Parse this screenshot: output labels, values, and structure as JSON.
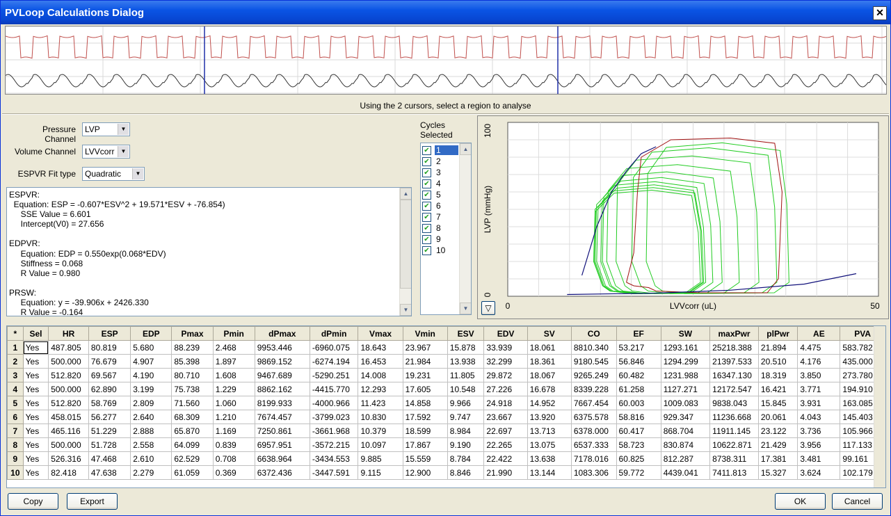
{
  "window": {
    "title": "PVLoop Calculations Dialog",
    "close_glyph": "✕"
  },
  "overview": {
    "hint": "Using the 2 cursors, select a region to analyse",
    "colors": {
      "pressure": "#c0504d",
      "volume": "#333333",
      "cursor": "#1f2fa8"
    }
  },
  "settings": {
    "pressure_label": "Pressure Channel",
    "pressure_value": "LVP",
    "volume_label": "Volume Channel",
    "volume_value": "LVVcorr",
    "espvr_label": "ESPVR Fit type",
    "espvr_value": "Quadratic"
  },
  "results_text": [
    "ESPVR:",
    "  Equation: ESP = -0.607*ESV^2 + 19.571*ESV + -76.854)",
    "     SSE Value = 6.601",
    "     Intercept(V0) = 27.656",
    "",
    "EDPVR:",
    "     Equation: EDP = 0.550exp(0.068*EDV)",
    "     Stiffness = 0.068",
    "     R Value = 0.980",
    "",
    "PRSW:",
    "     Equation: y = -39.906x + 2426.330",
    "     R Value = -0.164"
  ],
  "cycles": {
    "label_line1": "Cycles",
    "label_line2": "Selected",
    "items": [
      "1",
      "2",
      "3",
      "4",
      "5",
      "6",
      "7",
      "8",
      "9",
      "10"
    ],
    "selected_index": 0
  },
  "chart_data": {
    "type": "line",
    "xlabel": "LVVcorr (uL)",
    "ylabel": "LVP (mmHg)",
    "xlim": [
      0,
      50
    ],
    "ylim": [
      0,
      100
    ],
    "x_ticks": [
      "0",
      "50"
    ],
    "y_ticks": [
      "0",
      "100"
    ],
    "grid": true,
    "colors": {
      "loops": "#22cc22",
      "highlight": "#a01010",
      "fit": "#10107a"
    },
    "espvr_curve": [
      [
        10,
        12
      ],
      [
        12,
        40
      ],
      [
        14,
        60
      ],
      [
        16,
        72
      ],
      [
        18,
        82
      ],
      [
        20,
        86
      ]
    ],
    "edpvr_curve": [
      [
        8,
        1
      ],
      [
        20,
        1.8
      ],
      [
        30,
        3.5
      ],
      [
        40,
        7
      ],
      [
        47,
        13
      ]
    ],
    "highlight_loop": [
      [
        16,
        8
      ],
      [
        17,
        25
      ],
      [
        17.5,
        60
      ],
      [
        18,
        80
      ],
      [
        22,
        90
      ],
      [
        30,
        91
      ],
      [
        36,
        88
      ],
      [
        37,
        60
      ],
      [
        36.5,
        10
      ],
      [
        35,
        2
      ],
      [
        26,
        2
      ],
      [
        20,
        3
      ],
      [
        19,
        5
      ],
      [
        17,
        6
      ],
      [
        16,
        8
      ]
    ],
    "loops": [
      {
        "esv": 15.878,
        "edv": 33.939,
        "pmax": 88.239
      },
      {
        "esv": 13.938,
        "edv": 32.299,
        "pmax": 85.398
      },
      {
        "esv": 11.805,
        "edv": 29.872,
        "pmax": 80.71
      },
      {
        "esv": 10.548,
        "edv": 27.226,
        "pmax": 75.738
      },
      {
        "esv": 9.966,
        "edv": 24.918,
        "pmax": 71.56
      },
      {
        "esv": 9.747,
        "edv": 23.667,
        "pmax": 68.309
      },
      {
        "esv": 8.984,
        "edv": 22.697,
        "pmax": 65.87
      },
      {
        "esv": 9.19,
        "edv": 22.265,
        "pmax": 64.099
      },
      {
        "esv": 8.784,
        "edv": 22.422,
        "pmax": 62.529
      },
      {
        "esv": 8.846,
        "edv": 21.99,
        "pmax": 61.059
      }
    ],
    "zoom_glyph": "▽"
  },
  "table": {
    "corner": "*",
    "columns": [
      "Sel",
      "HR",
      "ESP",
      "EDP",
      "Pmax",
      "Pmin",
      "dPmax",
      "dPmin",
      "Vmax",
      "Vmin",
      "ESV",
      "EDV",
      "SV",
      "CO",
      "EF",
      "SW",
      "maxPwr",
      "plPwr",
      "AE",
      "PVA"
    ],
    "rows": [
      [
        "Yes",
        "487.805",
        "80.819",
        "5.680",
        "88.239",
        "2.468",
        "9953.446",
        "-6960.075",
        "18.643",
        "23.967",
        "15.878",
        "33.939",
        "18.061",
        "8810.340",
        "53.217",
        "1293.161",
        "25218.388",
        "21.894",
        "4.475",
        "583.782"
      ],
      [
        "Yes",
        "500.000",
        "76.679",
        "4.907",
        "85.398",
        "1.897",
        "9869.152",
        "-6274.194",
        "16.453",
        "21.984",
        "13.938",
        "32.299",
        "18.361",
        "9180.545",
        "56.846",
        "1294.299",
        "21397.533",
        "20.510",
        "4.176",
        "435.000"
      ],
      [
        "Yes",
        "512.820",
        "69.567",
        "4.190",
        "80.710",
        "1.608",
        "9467.689",
        "-5290.251",
        "14.008",
        "19.231",
        "11.805",
        "29.872",
        "18.067",
        "9265.249",
        "60.482",
        "1231.988",
        "16347.130",
        "18.319",
        "3.850",
        "273.780"
      ],
      [
        "Yes",
        "500.000",
        "62.890",
        "3.199",
        "75.738",
        "1.229",
        "8862.162",
        "-4415.770",
        "12.293",
        "17.605",
        "10.548",
        "27.226",
        "16.678",
        "8339.228",
        "61.258",
        "1127.271",
        "12172.547",
        "16.421",
        "3.771",
        "194.910"
      ],
      [
        "Yes",
        "512.820",
        "58.769",
        "2.809",
        "71.560",
        "1.060",
        "8199.933",
        "-4000.966",
        "11.423",
        "14.858",
        "9.966",
        "24.918",
        "14.952",
        "7667.454",
        "60.003",
        "1009.083",
        "9838.043",
        "15.845",
        "3.931",
        "163.085"
      ],
      [
        "Yes",
        "458.015",
        "56.277",
        "2.640",
        "68.309",
        "1.210",
        "7674.457",
        "-3799.023",
        "10.830",
        "17.592",
        "9.747",
        "23.667",
        "13.920",
        "6375.578",
        "58.816",
        "929.347",
        "11236.668",
        "20.061",
        "4.043",
        "145.403"
      ],
      [
        "Yes",
        "465.116",
        "51.229",
        "2.888",
        "65.870",
        "1.169",
        "7250.861",
        "-3661.968",
        "10.379",
        "18.599",
        "8.984",
        "22.697",
        "13.713",
        "6378.000",
        "60.417",
        "868.704",
        "11911.145",
        "23.122",
        "3.736",
        "105.966"
      ],
      [
        "Yes",
        "500.000",
        "51.728",
        "2.558",
        "64.099",
        "0.839",
        "6957.951",
        "-3572.215",
        "10.097",
        "17.867",
        "9.190",
        "22.265",
        "13.075",
        "6537.333",
        "58.723",
        "830.874",
        "10622.871",
        "21.429",
        "3.956",
        "117.133"
      ],
      [
        "Yes",
        "526.316",
        "47.468",
        "2.610",
        "62.529",
        "0.708",
        "6638.964",
        "-3434.553",
        "9.885",
        "15.559",
        "8.784",
        "22.422",
        "13.638",
        "7178.016",
        "60.825",
        "812.287",
        "8738.311",
        "17.381",
        "3.481",
        "99.161"
      ],
      [
        "Yes",
        "82.418",
        "47.638",
        "2.279",
        "61.059",
        "0.369",
        "6372.436",
        "-3447.591",
        "9.115",
        "12.900",
        "8.846",
        "21.990",
        "13.144",
        "1083.306",
        "59.772",
        "4439.041",
        "7411.813",
        "15.327",
        "3.624",
        "102.179"
      ]
    ]
  },
  "buttons": {
    "copy": "Copy",
    "export": "Export",
    "ok": "OK",
    "cancel": "Cancel"
  }
}
